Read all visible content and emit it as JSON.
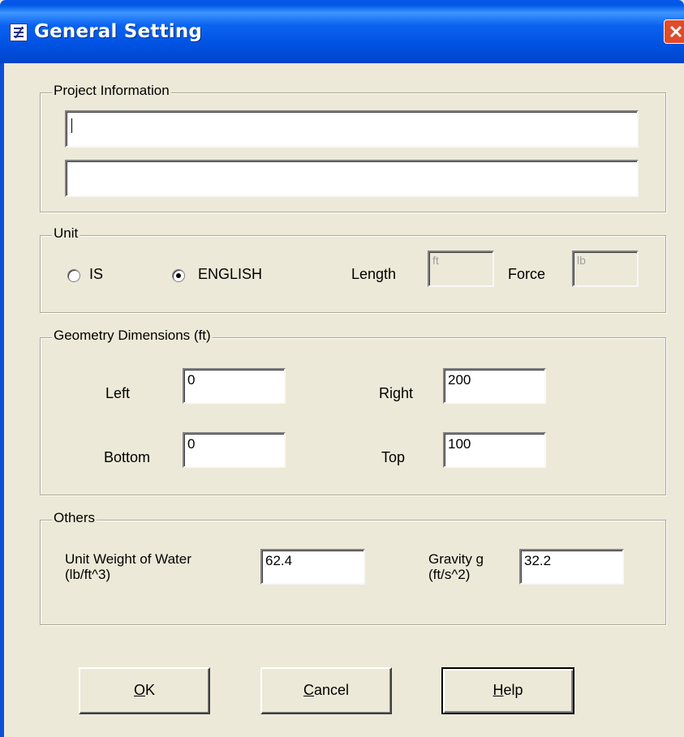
{
  "window": {
    "title": "General Setting"
  },
  "project_info": {
    "legend": "Project Information",
    "line1_value": "",
    "line2_value": ""
  },
  "unit": {
    "legend": "Unit",
    "options": [
      {
        "label": "IS",
        "selected": false
      },
      {
        "label": "ENGLISH",
        "selected": true
      }
    ],
    "length_label": "Length",
    "length_value": "ft",
    "force_label": "Force",
    "force_value": "lb"
  },
  "geometry": {
    "legend": "Geometry Dimensions  (ft)",
    "left_label": "Left",
    "left_value": "0",
    "right_label": "Right",
    "right_value": "200",
    "bottom_label": "Bottom",
    "bottom_value": "0",
    "top_label": "Top",
    "top_value": "100"
  },
  "others": {
    "legend": "Others",
    "water_label_line1": "Unit Weight of Water",
    "water_label_line2": "(lb/ft^3)",
    "water_value": "62.4",
    "gravity_label_line1": "Gravity g",
    "gravity_label_line2": "(ft/s^2)",
    "gravity_value": "32.2"
  },
  "buttons": {
    "ok": {
      "mnemonic": "O",
      "rest": "K"
    },
    "cancel": {
      "mnemonic": "C",
      "rest": "ancel"
    },
    "help": {
      "mnemonic": "H",
      "rest": "elp"
    }
  },
  "icons": {
    "app": "app-icon",
    "close": "close-icon",
    "radio": "radio-icon"
  },
  "colors": {
    "titlebar": "#0a55ea",
    "dialog_bg": "#ece9d8",
    "close": "#e04b2a"
  }
}
